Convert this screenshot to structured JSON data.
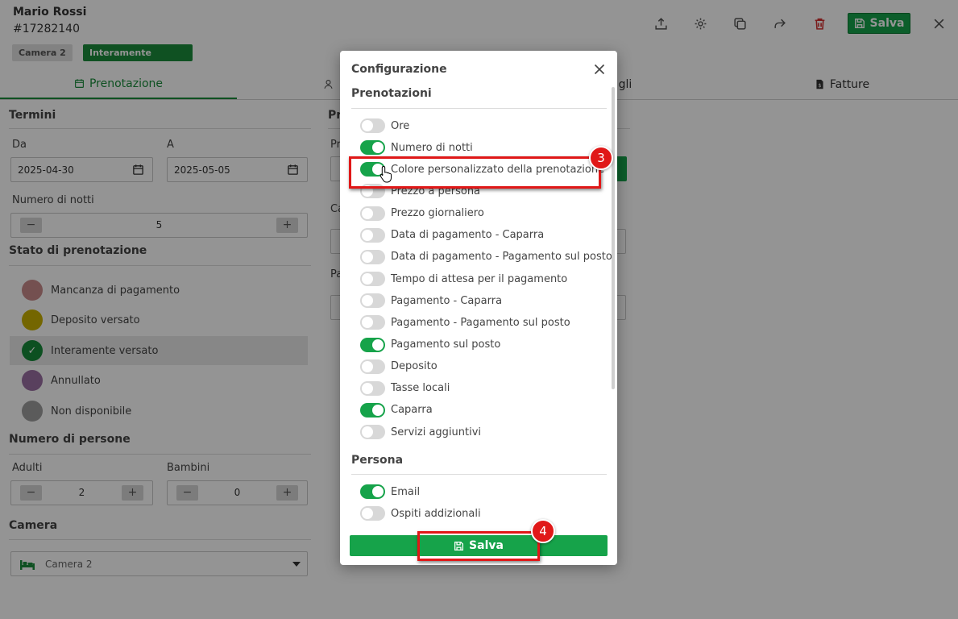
{
  "header": {
    "guest_name": "Mario Rossi",
    "booking_id": "#17282140",
    "room_badge": "Camera 2",
    "status_badge": "Interamente versato",
    "save_label": "Salva"
  },
  "tabs": [
    {
      "label": "Prenotazione",
      "active": true
    },
    {
      "label": "",
      "active": false
    },
    {
      "label": "gli",
      "active": false
    },
    {
      "label": "Fatture",
      "active": false
    }
  ],
  "terms": {
    "title": "Termini",
    "from_label": "Da",
    "from_value": "2025-04-30",
    "to_label": "A",
    "to_value": "2025-05-05",
    "nights_label": "Numero di notti",
    "nights_value": "5"
  },
  "booking_status": {
    "title": "Stato di prenotazione",
    "items": [
      {
        "label": "Mancanza di pagamento",
        "color": "#c98a8a",
        "selected": false
      },
      {
        "label": "Deposito versato",
        "color": "#c9b000",
        "selected": false
      },
      {
        "label": "Interamente versato",
        "color": "#178a3a",
        "selected": true,
        "check": "✓"
      },
      {
        "label": "Annullato",
        "color": "#9a6ea3",
        "selected": false
      },
      {
        "label": "Non disponibile",
        "color": "#9e9e9e",
        "selected": false
      }
    ]
  },
  "persons": {
    "title": "Numero di persone",
    "adults_label": "Adulti",
    "adults_value": "2",
    "children_label": "Bambini",
    "children_value": "0",
    "minus": "−",
    "plus": "+"
  },
  "room": {
    "title": "Camera",
    "value": "Camera 2"
  },
  "middle": {
    "frag1": "Pr",
    "frag2": "Pr",
    "frag3": "Ca",
    "frag4": "Pa"
  },
  "modal": {
    "title": "Configurazione",
    "section_bookings": "Prenotazioni",
    "section_person": "Persona",
    "save_label": "Salva",
    "bookings_options": [
      {
        "label": "Ore",
        "on": false
      },
      {
        "label": "Numero di notti",
        "on": true
      },
      {
        "label": "Colore personalizzato della prenotazione",
        "on": true
      },
      {
        "label": "Prezzo a persona",
        "on": false
      },
      {
        "label": "Prezzo giornaliero",
        "on": false
      },
      {
        "label": "Data di pagamento - Caparra",
        "on": false
      },
      {
        "label": "Data di pagamento - Pagamento sul posto",
        "on": false
      },
      {
        "label": "Tempo di attesa per il pagamento",
        "on": false
      },
      {
        "label": "Pagamento - Caparra",
        "on": false
      },
      {
        "label": "Pagamento - Pagamento sul posto",
        "on": false
      },
      {
        "label": "Pagamento sul posto",
        "on": true
      },
      {
        "label": "Deposito",
        "on": false
      },
      {
        "label": "Tasse locali",
        "on": false
      },
      {
        "label": "Caparra",
        "on": true
      },
      {
        "label": "Servizi aggiuntivi",
        "on": false
      }
    ],
    "person_options": [
      {
        "label": "Email",
        "on": true
      },
      {
        "label": "Ospiti addizionali",
        "on": false
      }
    ]
  },
  "annotations": {
    "step3": "3",
    "step4": "4"
  }
}
